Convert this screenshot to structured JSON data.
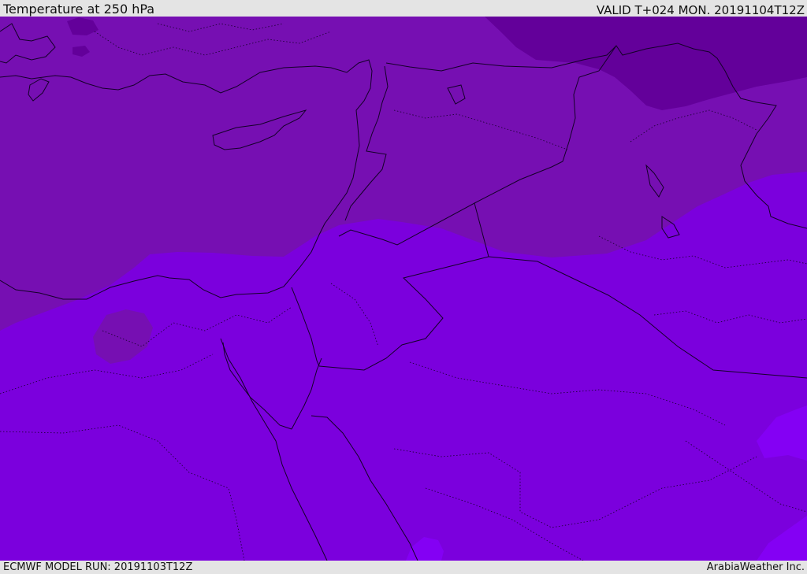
{
  "header": {
    "title": "Temperature at 250 hPa",
    "valid": "VALID T+024 MON. 20191104T12Z"
  },
  "footer": {
    "model_run": "ECMWF MODEL RUN: 20191103T12Z",
    "credit": "ArabiaWeather Inc."
  },
  "colors": {
    "band_coldest": "#63009a",
    "band_cold": "#760fb2",
    "band_mid": "#7b00dd",
    "band_warm": "#8400f4",
    "border_line": "#140028",
    "frame_bg": "#e4e4e4"
  }
}
